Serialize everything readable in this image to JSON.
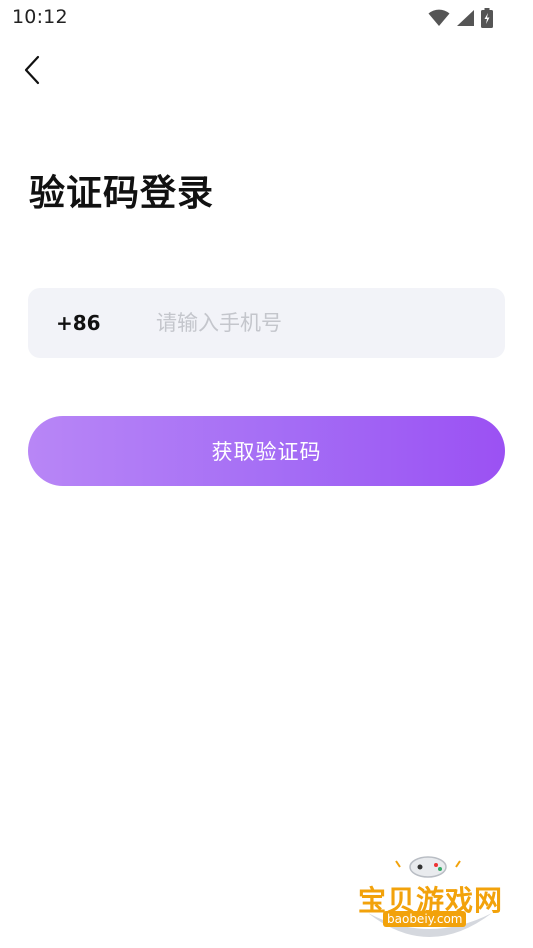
{
  "status_bar": {
    "time": "10:12",
    "icons": [
      "wifi-icon",
      "cell-signal-icon",
      "battery-charging-icon"
    ]
  },
  "nav": {
    "back_icon": "chevron-left-icon"
  },
  "page": {
    "title": "验证码登录"
  },
  "phone_form": {
    "country_code": "+86",
    "phone_value": "",
    "phone_placeholder": "请输入手机号"
  },
  "actions": {
    "get_code_label": "获取验证码"
  },
  "watermark": {
    "name": "宝贝游戏网",
    "url": "baobeiy.com"
  },
  "colors": {
    "accent_start": "#b886f6",
    "accent_end": "#9b51f3",
    "input_bg": "#f2f3f8",
    "placeholder": "#c4c6cc",
    "watermark": "#f2a20b"
  }
}
